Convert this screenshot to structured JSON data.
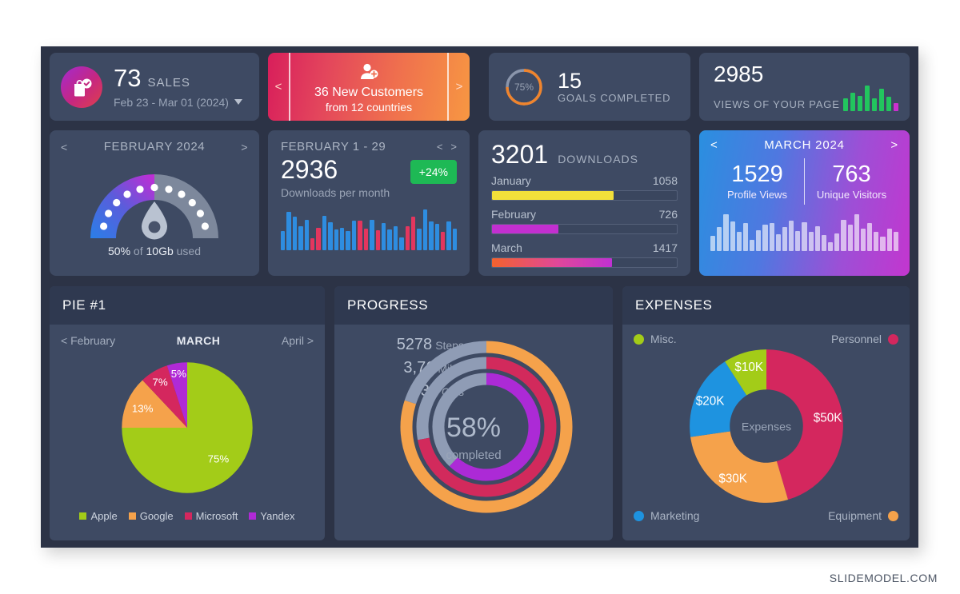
{
  "footer": {
    "brand": "SLIDEMODEL.COM"
  },
  "cards": {
    "sales": {
      "icon": "shopping-bag-check-icon",
      "value": "73",
      "label": "SALES",
      "date_range": "Feb 23 - Mar 01 (2024)"
    },
    "customers": {
      "icon": "add-user-icon",
      "prev": "<",
      "next": ">",
      "title": "36 New Customers",
      "subtitle": "from 12 countries"
    },
    "goals": {
      "ring_percent": "75%",
      "ring_value": 75,
      "value": "15",
      "label": "GOALS COMPLETED"
    },
    "views": {
      "value": "2985",
      "label": "VIEWS OF YOUR PAGE",
      "bars": [
        {
          "h": 52,
          "color": "#22c55e"
        },
        {
          "h": 72,
          "color": "#22c55e"
        },
        {
          "h": 62,
          "color": "#22c55e"
        },
        {
          "h": 100,
          "color": "#22c55e"
        },
        {
          "h": 50,
          "color": "#22c55e"
        },
        {
          "h": 88,
          "color": "#22c55e"
        },
        {
          "h": 56,
          "color": "#22c55e"
        },
        {
          "h": 34,
          "color": "#cc2fd0"
        }
      ]
    },
    "gauge": {
      "prev": "<",
      "next": ">",
      "title": "FEBRUARY 2024",
      "percent": "50%",
      "percent_value": 50,
      "footer_mid": "of",
      "capacity": "10Gb",
      "footer_end": "used",
      "icon": "water-drop-icon"
    },
    "downloads_month": {
      "title": "FEBRUARY 1 - 29",
      "prev": "<",
      "next": ">",
      "value": "2936",
      "badge": "+24%",
      "subtitle": "Downloads per month",
      "bars": [
        {
          "h": 44,
          "c": "b"
        },
        {
          "h": 88,
          "c": "b"
        },
        {
          "h": 78,
          "c": "b"
        },
        {
          "h": 55,
          "c": "b"
        },
        {
          "h": 70,
          "c": "b"
        },
        {
          "h": 28,
          "c": "r"
        },
        {
          "h": 52,
          "c": "r"
        },
        {
          "h": 80,
          "c": "b"
        },
        {
          "h": 64,
          "c": "b"
        },
        {
          "h": 48,
          "c": "b"
        },
        {
          "h": 52,
          "c": "b"
        },
        {
          "h": 45,
          "c": "b"
        },
        {
          "h": 68,
          "c": "b"
        },
        {
          "h": 68,
          "c": "r"
        },
        {
          "h": 50,
          "c": "r"
        },
        {
          "h": 70,
          "c": "b"
        },
        {
          "h": 46,
          "c": "r"
        },
        {
          "h": 63,
          "c": "b"
        },
        {
          "h": 48,
          "c": "b"
        },
        {
          "h": 55,
          "c": "b"
        },
        {
          "h": 30,
          "c": "b"
        },
        {
          "h": 56,
          "c": "r"
        },
        {
          "h": 78,
          "c": "r"
        },
        {
          "h": 50,
          "c": "b"
        },
        {
          "h": 94,
          "c": "b"
        },
        {
          "h": 66,
          "c": "b"
        },
        {
          "h": 60,
          "c": "b"
        },
        {
          "h": 42,
          "c": "r"
        },
        {
          "h": 66,
          "c": "b"
        },
        {
          "h": 50,
          "c": "b"
        }
      ],
      "colors": {
        "b": "#2e8de0",
        "r": "#e3365e"
      }
    },
    "downloads": {
      "total": "3201",
      "label": "DOWNLOADS",
      "items": [
        {
          "name": "January",
          "value": "1058",
          "pct": 66,
          "fill": "#f2e03a"
        },
        {
          "name": "February",
          "value": "726",
          "pct": 36,
          "fill": "#c22fd0"
        },
        {
          "name": "March",
          "value": "1417",
          "pct": 65,
          "fill": "linear-gradient(90deg,#f4622e 0%,#e0479a 55%,#bf31d2 100%)"
        }
      ]
    },
    "march": {
      "prev": "<",
      "next": ">",
      "title": "MARCH 2024",
      "left_value": "1529",
      "left_label": "Profile Views",
      "right_value": "763",
      "right_label": "Unique Visitors",
      "bars": [
        40,
        62,
        96,
        78,
        50,
        72,
        30,
        55,
        68,
        72,
        44,
        62,
        80,
        52,
        74,
        50,
        64,
        42,
        22,
        46,
        82,
        68,
        96,
        58,
        72,
        50,
        38,
        58,
        50
      ]
    }
  },
  "panels": {
    "pie": {
      "title": "PIE #1",
      "prev_label": "< February",
      "current": "MARCH",
      "next_label": "April >"
    },
    "progress": {
      "title": "PROGRESS",
      "percent": "58%",
      "percent_sub": "completed",
      "rows": [
        {
          "value": "5278",
          "unit": "Steps",
          "pct": 80,
          "color": "#f5a24b"
        },
        {
          "value": "3,76",
          "unit": "Miles",
          "pct": 72,
          "color": "#d22a5c"
        },
        {
          "value": "736",
          "unit": "Cals",
          "pct": 62,
          "color": "#ac2ad6"
        }
      ],
      "track_color": "#8f9cb5"
    },
    "expenses": {
      "title": "EXPENSES",
      "center_label": "Expenses",
      "legend": [
        {
          "name": "Misc.",
          "color": "#a3cc18",
          "pos": "tl"
        },
        {
          "name": "Personnel",
          "color": "#d4275e",
          "pos": "tr"
        },
        {
          "name": "Marketing",
          "color": "#1e93e0",
          "pos": "bl"
        },
        {
          "name": "Equipment",
          "color": "#f5a24b",
          "pos": "br"
        }
      ]
    }
  },
  "chart_data": [
    {
      "type": "pie",
      "title": "PIE #1",
      "period": "MARCH",
      "categories": [
        "Apple",
        "Google",
        "Microsoft",
        "Yandex"
      ],
      "values": [
        75,
        13,
        7,
        5
      ],
      "labels": [
        "75%",
        "13%",
        "7%",
        "5%"
      ],
      "colors": [
        "#a3cc18",
        "#f5a24b",
        "#d4275e",
        "#b02ad6"
      ],
      "legend": "bottom"
    },
    {
      "type": "bar",
      "title": "3201 DOWNLOADS",
      "categories": [
        "January",
        "February",
        "March"
      ],
      "values": [
        1058,
        726,
        1417
      ],
      "ylabel": "",
      "xlabel": ""
    },
    {
      "type": "pie",
      "title": "EXPENSES",
      "categories": [
        "Personnel",
        "Equipment",
        "Marketing",
        "Misc."
      ],
      "values": [
        50,
        30,
        20,
        10
      ],
      "labels": [
        "$50K",
        "$30K",
        "$20K",
        "$10K"
      ],
      "colors": [
        "#d4275e",
        "#f5a24b",
        "#1e93e0",
        "#a3cc18"
      ],
      "legend": "corners"
    },
    {
      "type": "bar",
      "title": "PROGRESS",
      "categories": [
        "Steps",
        "Miles",
        "Cals"
      ],
      "values": [
        5278,
        3.76,
        736
      ],
      "series": [
        {
          "name": "completion",
          "values": [
            80,
            72,
            62
          ]
        }
      ],
      "ylim": [
        0,
        100
      ]
    }
  ]
}
